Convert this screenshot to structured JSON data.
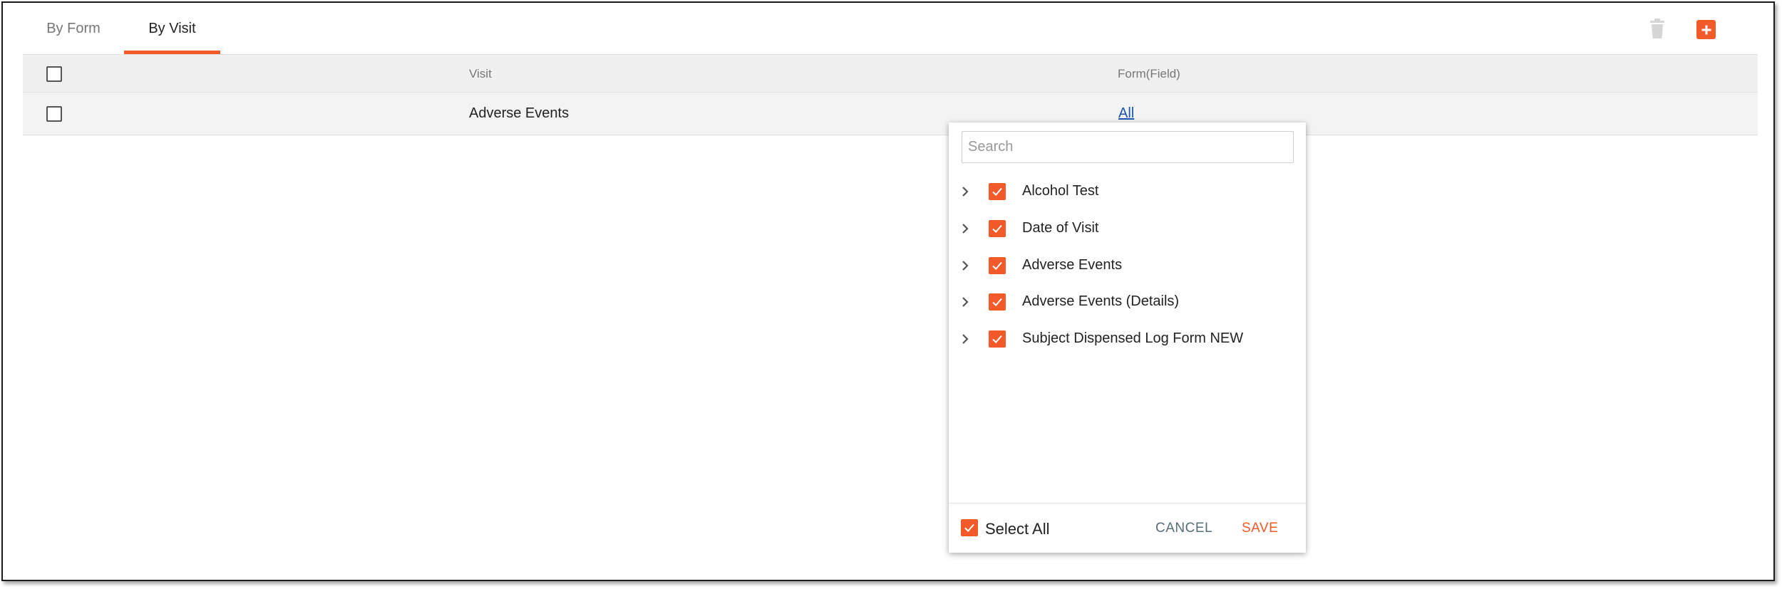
{
  "tabs": [
    {
      "label": "By Form",
      "active": false
    },
    {
      "label": "By Visit",
      "active": true
    }
  ],
  "toolbar": {
    "delete_icon": "trash-icon",
    "add_icon": "plus-icon",
    "accent": "#f25a29"
  },
  "table": {
    "headers": {
      "visit": "Visit",
      "form_field": "Form(Field)"
    },
    "rows": [
      {
        "visit": "Adverse Events",
        "form_field": "All"
      }
    ]
  },
  "popover": {
    "search_placeholder": "Search",
    "items": [
      {
        "label": "Alcohol Test",
        "checked": true
      },
      {
        "label": "Date of Visit",
        "checked": true
      },
      {
        "label": "Adverse Events",
        "checked": true
      },
      {
        "label": "Adverse Events (Details)",
        "checked": true
      },
      {
        "label": "Subject Dispensed Log Form NEW",
        "checked": true
      }
    ],
    "select_all_label": "Select All",
    "cancel_label": "CANCEL",
    "save_label": "SAVE"
  }
}
